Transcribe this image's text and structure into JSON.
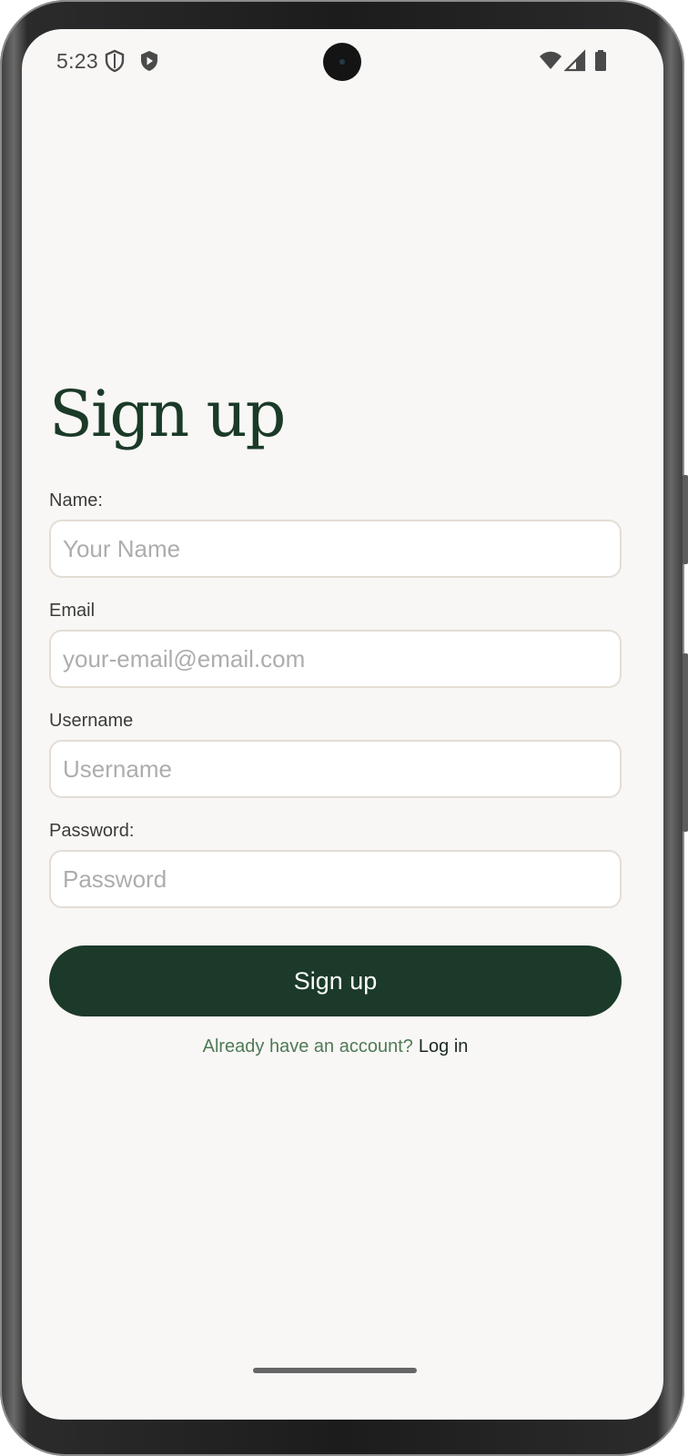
{
  "status_bar": {
    "time": "5:23",
    "left_icons": [
      "shield-icon",
      "play-protect-icon"
    ],
    "right_icons": [
      "wifi-icon",
      "cell-signal-icon",
      "battery-icon"
    ]
  },
  "form": {
    "title": "Sign up",
    "fields": [
      {
        "label": "Name:",
        "placeholder": "Your Name"
      },
      {
        "label": "Email",
        "placeholder": "your-email@email.com"
      },
      {
        "label": "Username",
        "placeholder": "Username"
      },
      {
        "label": "Password:",
        "placeholder": "Password"
      }
    ],
    "submit_label": "Sign up",
    "login_prompt": "Already have an account?",
    "login_link": "Log in"
  },
  "colors": {
    "background": "#f8f7f5",
    "brand_green": "#1c3a29",
    "prompt_green": "#4f7a56",
    "input_border": "#e3ddd4"
  }
}
